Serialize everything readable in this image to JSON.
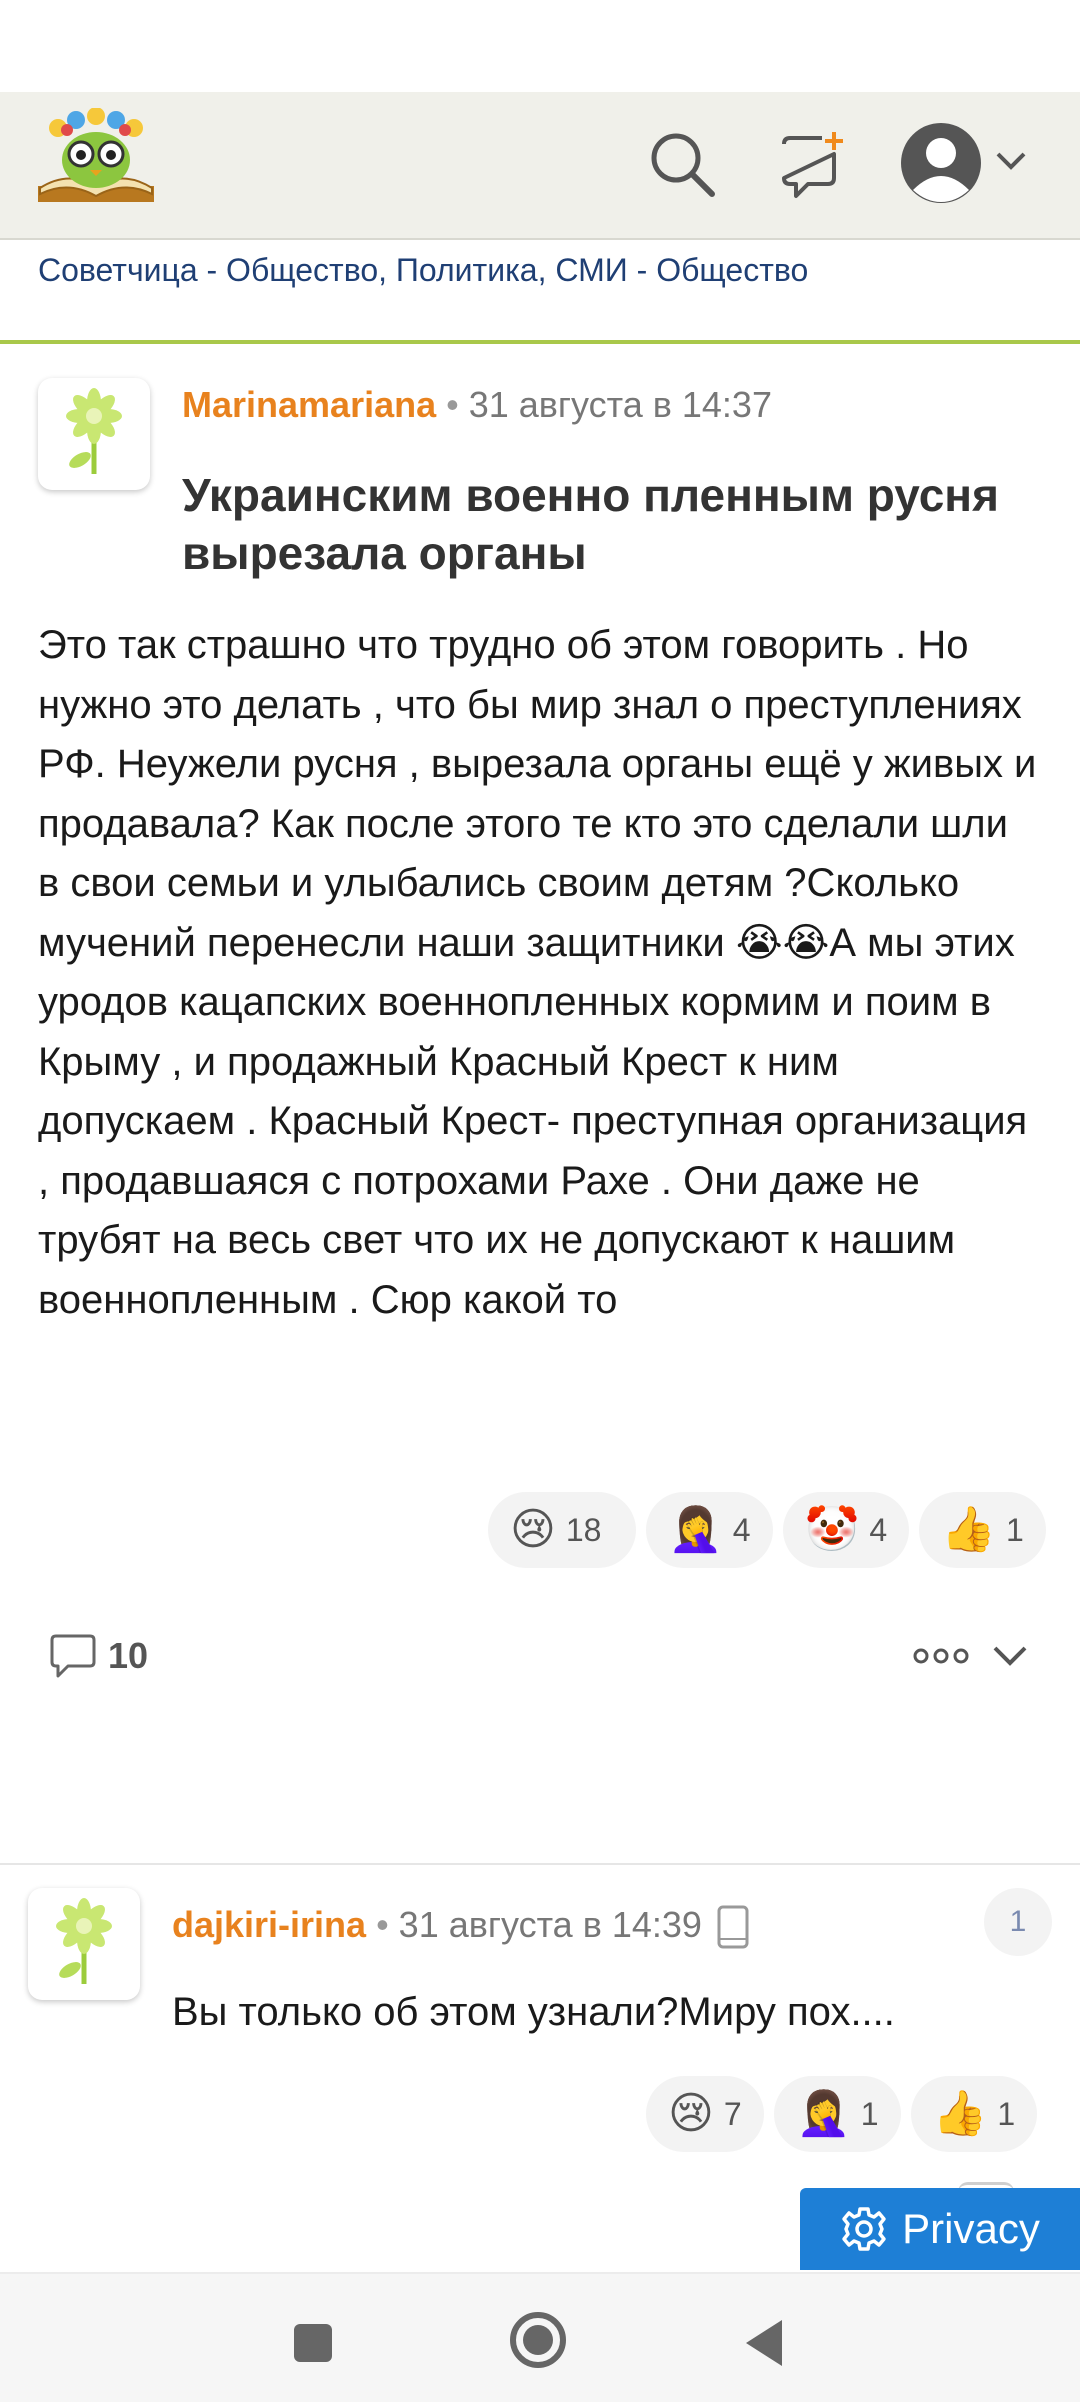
{
  "header": {
    "logo_name": "sovetchica-owl-logo",
    "profile_chevron": "chevron-down-icon"
  },
  "breadcrumb": "Советчица - Общество, Политика, СМИ - Общество",
  "post": {
    "author": "Marinamariana",
    "separator": "•",
    "date": "31 августа в 14:37",
    "title": "Украинским военно пленным русня вырезала органы",
    "body": "Это так страшно что трудно об этом говорить . Но нужно это делать , что бы мир знал о преступлениях РФ. Неужели русня , вырезала органы ещё у живых и продавала? Как после этого те кто это сделали шли в свои семьи и улыбались своим детям ?Сколько мучений перенесли наши защитники 😭😭А мы этих уродов кацапских военнопленных кормим и поим в Крыму , и продажный Красный Крест к ним допускаем . Красный Крест- преступная организация , продавшаяся с потрохами Рахе . Они даже не трубят на весь свет что их не допускают к нашим военнопленным . Сюр какой то",
    "reactions": [
      {
        "emoji": "😢",
        "count": "18"
      },
      {
        "emoji": "🤦‍♀️",
        "count": "4"
      },
      {
        "emoji": "🤡",
        "count": "4"
      },
      {
        "emoji": "👍",
        "count": "1"
      }
    ],
    "comments_count": "10"
  },
  "comment": {
    "author": "dajkiri-irina",
    "separator": "•",
    "date": "31 августа в 14:39",
    "badge": "1",
    "body": "Вы только об этом узнали?Миру пох....",
    "reactions": [
      {
        "emoji": "😢",
        "count": "7"
      },
      {
        "emoji": "🤦‍♀️",
        "count": "1"
      },
      {
        "emoji": "👍",
        "count": "1"
      }
    ]
  },
  "privacy_label": "Privacy"
}
